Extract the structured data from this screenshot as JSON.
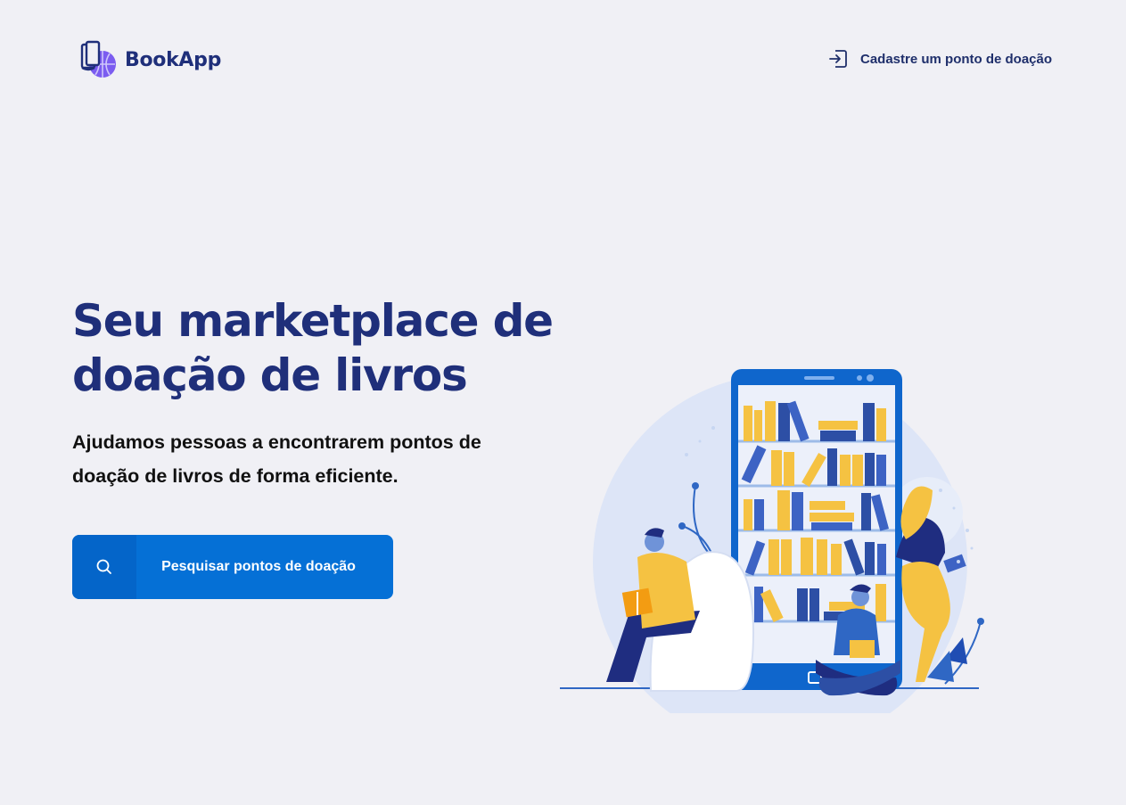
{
  "header": {
    "brand": "BookApp",
    "register_link": "Cadastre um ponto de doação",
    "register_icon": "log-in-icon",
    "logo_icon": "book-globe-logo-icon"
  },
  "hero": {
    "title": "Seu marketplace de doação de livros",
    "subtitle": "Ajudamos pessoas a encontrarem pontos de doação de livros de forma eficiente.",
    "search_button": "Pesquisar pontos de doação",
    "search_icon": "search-icon"
  },
  "colors": {
    "background": "#f0f0f5",
    "primary": "#0570d6",
    "primary_dark": "#0465c9",
    "title": "#1f2f7a",
    "accent_yellow": "#f5c242"
  }
}
